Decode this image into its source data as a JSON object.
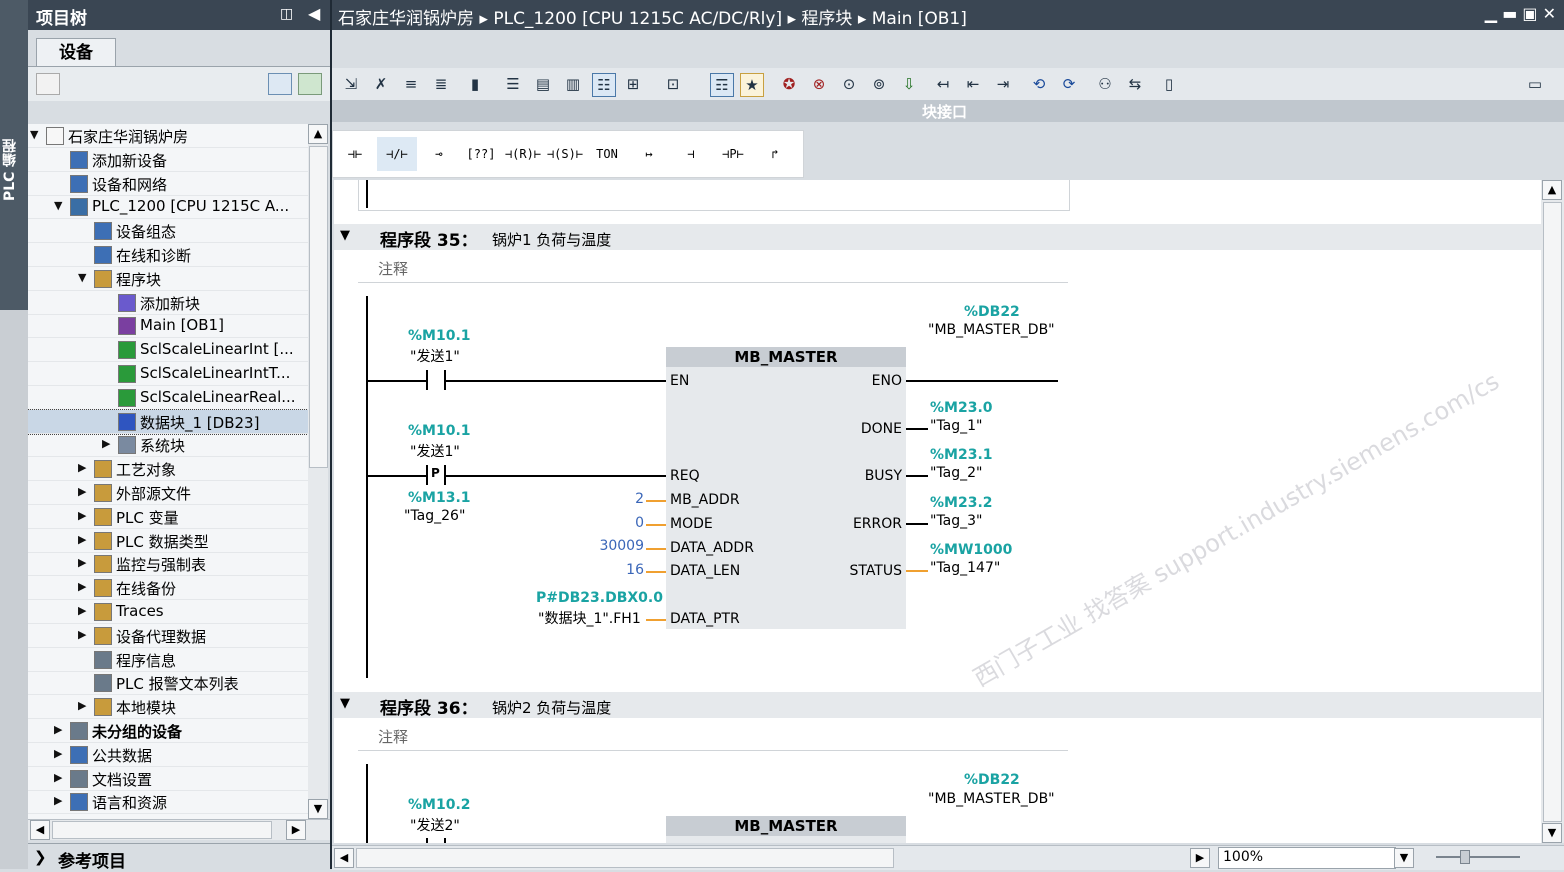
{
  "sidebar": {
    "vertical_tab": "PLC 编程"
  },
  "tree": {
    "title": "项目树",
    "tab": "设备",
    "items": [
      {
        "label": "石家庄华润锅炉房",
        "arrow": "▼",
        "bold": false
      },
      {
        "label": "添加新设备",
        "arrow": "",
        "bold": false
      },
      {
        "label": "设备和网络",
        "arrow": "",
        "bold": false
      },
      {
        "label": "PLC_1200 [CPU 1215C A...",
        "arrow": "▼",
        "bold": false
      },
      {
        "label": "设备组态",
        "arrow": "",
        "bold": false
      },
      {
        "label": "在线和诊断",
        "arrow": "",
        "bold": false
      },
      {
        "label": "程序块",
        "arrow": "▼",
        "bold": false
      },
      {
        "label": "添加新块",
        "arrow": "",
        "bold": false
      },
      {
        "label": "Main [OB1]",
        "arrow": "",
        "bold": false
      },
      {
        "label": "SclScaleLinearInt [...",
        "arrow": "",
        "bold": false
      },
      {
        "label": "SclScaleLinearIntT...",
        "arrow": "",
        "bold": false
      },
      {
        "label": "SclScaleLinearReal...",
        "arrow": "",
        "bold": false
      },
      {
        "label": "数据块_1 [DB23]",
        "arrow": "",
        "bold": false
      },
      {
        "label": "系统块",
        "arrow": "▶",
        "bold": false
      },
      {
        "label": "工艺对象",
        "arrow": "▶",
        "bold": false
      },
      {
        "label": "外部源文件",
        "arrow": "▶",
        "bold": false
      },
      {
        "label": "PLC 变量",
        "arrow": "▶",
        "bold": false
      },
      {
        "label": "PLC 数据类型",
        "arrow": "▶",
        "bold": false
      },
      {
        "label": "监控与强制表",
        "arrow": "▶",
        "bold": false
      },
      {
        "label": "在线备份",
        "arrow": "▶",
        "bold": false
      },
      {
        "label": "Traces",
        "arrow": "▶",
        "bold": false
      },
      {
        "label": "设备代理数据",
        "arrow": "▶",
        "bold": false
      },
      {
        "label": "程序信息",
        "arrow": "",
        "bold": false
      },
      {
        "label": "PLC 报警文本列表",
        "arrow": "",
        "bold": false
      },
      {
        "label": "本地模块",
        "arrow": "▶",
        "bold": false
      },
      {
        "label": "未分组的设备",
        "arrow": "▶",
        "bold": true
      },
      {
        "label": "公共数据",
        "arrow": "▶",
        "bold": false
      },
      {
        "label": "文档设置",
        "arrow": "▶",
        "bold": false
      },
      {
        "label": "语言和资源",
        "arrow": "▶",
        "bold": false
      }
    ],
    "reference_bar": "参考项目",
    "reference_arrow": "❯"
  },
  "main": {
    "breadcrumb": "石家庄华润锅炉房 ▸ PLC_1200 [CPU 1215C AC/DC/Rly] ▸ 程序块 ▸ Main [OB1]",
    "window_controls": "▁ ▬ ▣ ✕",
    "interface_label": "块接口",
    "zoom": "100%",
    "lad_buttons": [
      "⊣⊢",
      "⊣/⊢",
      "⊸",
      "[??]",
      "⊣(R)⊢",
      "⊣(S)⊢",
      "TON",
      "↦",
      "⊣",
      "⊣P⊢",
      "↱"
    ]
  },
  "network35": {
    "title": "程序段 35：",
    "comment_title": "锅炉1 负荷与温度",
    "comment_placeholder": "注释",
    "db_addr": "%DB22",
    "db_name": "\"MB_MASTER_DB\"",
    "block_name": "MB_MASTER",
    "en_tag_addr": "%M10.1",
    "en_tag_name": "\"发送1\"",
    "req_tag_addr": "%M10.1",
    "req_tag_name": "\"发送1\"",
    "p_label": "P",
    "edge_tag_addr": "%M13.1",
    "edge_tag_name": "\"Tag_26\"",
    "pins_left": [
      "EN",
      "REQ",
      "MB_ADDR",
      "MODE",
      "DATA_ADDR",
      "DATA_LEN",
      "DATA_PTR"
    ],
    "pins_right": [
      "ENO",
      "DONE",
      "BUSY",
      "ERROR",
      "STATUS"
    ],
    "mb_addr": "2",
    "mode": "0",
    "data_addr": "30009",
    "data_len": "16",
    "data_ptr_addr": "P#DB23.DBX0.0",
    "data_ptr_name": "\"数据块_1\".FH1",
    "done_addr": "%M23.0",
    "done_name": "\"Tag_1\"",
    "busy_addr": "%M23.1",
    "busy_name": "\"Tag_2\"",
    "error_addr": "%M23.2",
    "error_name": "\"Tag_3\"",
    "status_addr": "%MW1000",
    "status_name": "\"Tag_147\""
  },
  "network36": {
    "title": "程序段 36：",
    "comment_title": "锅炉2 负荷与温度",
    "comment_placeholder": "注释",
    "db_addr": "%DB22",
    "db_name": "\"MB_MASTER_DB\"",
    "block_name": "MB_MASTER",
    "en_tag_addr": "%M10.2",
    "en_tag_name": "\"发送2\""
  },
  "watermark": "西门子工业 找答案 support.industry.siemens.com/cs",
  "colors": {
    "titlebar": "#3a4653",
    "tag_teal": "#1aa3a3",
    "param_blue": "#3a66b8",
    "wire_orange": "#f0a030"
  }
}
